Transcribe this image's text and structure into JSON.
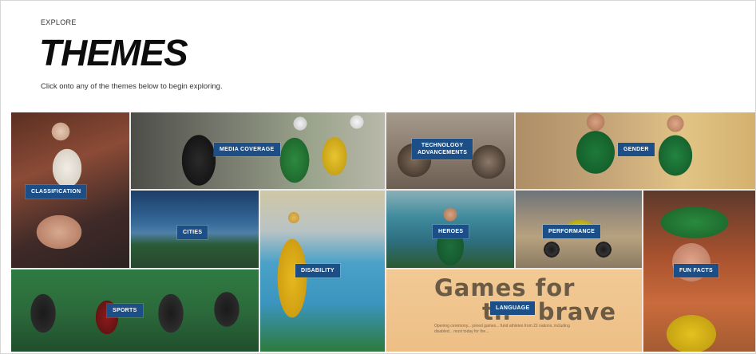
{
  "header": {
    "eyebrow": "EXPLORE",
    "title": "THEMES",
    "subtitle": "Click onto any of the themes below to begin exploring."
  },
  "themes": {
    "classification": "CLASSIFICATION",
    "media_coverage": "MEDIA COVERAGE",
    "technology_line1": "TECHNOLOGY",
    "technology_line2": "ADVANCEMENTS",
    "gender": "GENDER",
    "cities": "CITIES",
    "disability": "DISABILITY",
    "heroes": "HEROES",
    "performance": "PERFORMANCE",
    "fun_facts": "FUN FACTS",
    "sports": "SPORTS",
    "language": "LANGUAGE"
  },
  "newspaper": {
    "headline_line1": "Games for",
    "headline_line2": "th   brave",
    "body": "Opening ceremony... joined games... fund athletes from 22 nations, including disabled... most today for the..."
  },
  "colors": {
    "label_bg": "#1c4f88",
    "label_text": "#ffffff",
    "title": "#0d0d0d"
  }
}
